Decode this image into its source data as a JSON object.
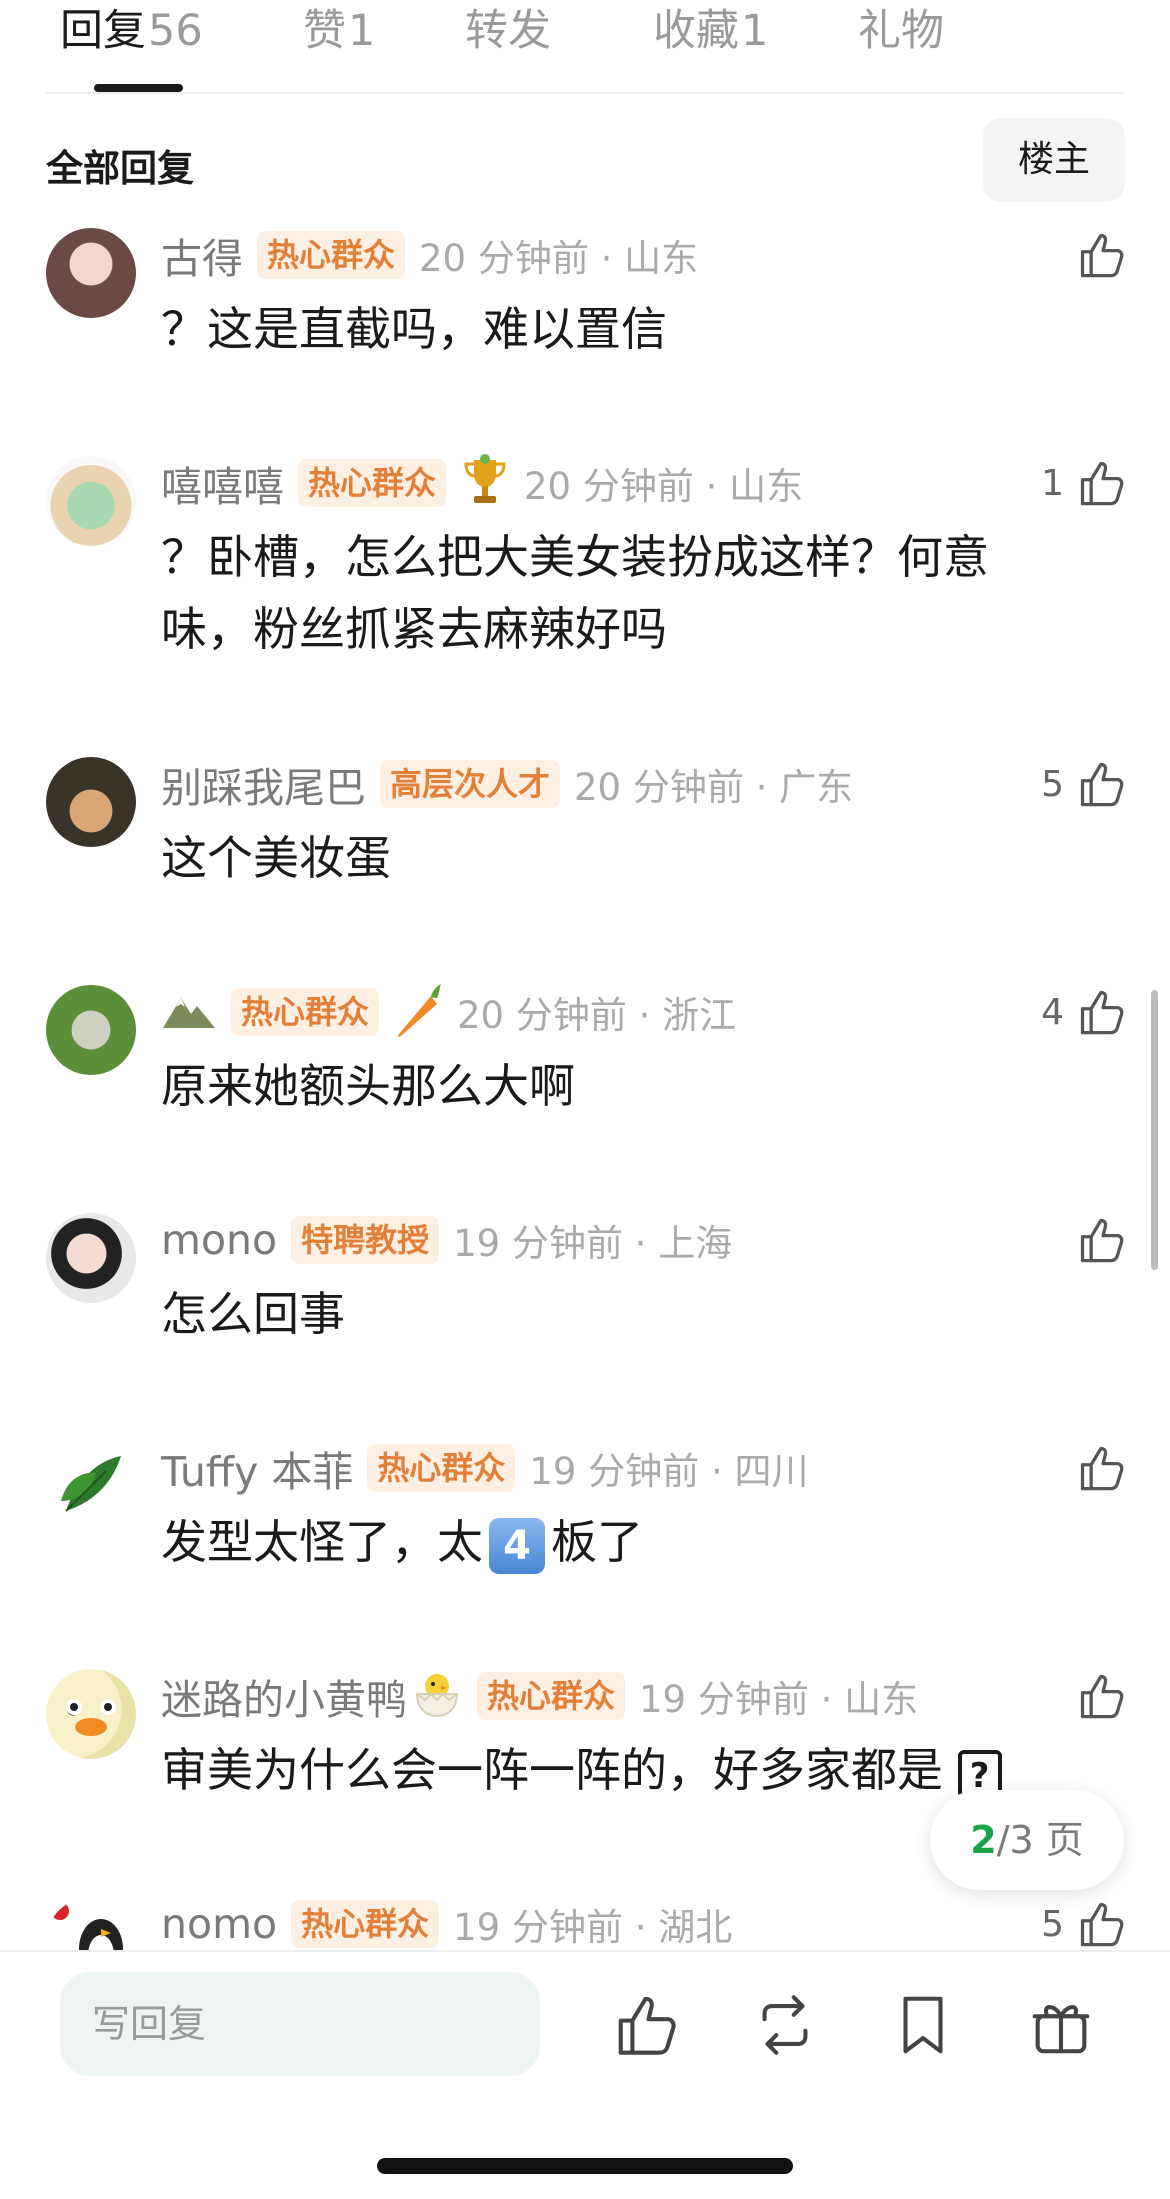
{
  "tabs": [
    {
      "label": "回复",
      "count": "56"
    },
    {
      "label": "赞",
      "count": "1"
    },
    {
      "label": "转发",
      "count": ""
    },
    {
      "label": "收藏",
      "count": "1"
    },
    {
      "label": "礼物",
      "count": ""
    }
  ],
  "section": {
    "title": "全部回复",
    "owner_filter": "楼主"
  },
  "comments": [
    {
      "name": "古得",
      "badge": "热心群众",
      "time": "20 分钟前 · 山东",
      "text": "？这是直截吗，难以置信",
      "likes": "",
      "badge_emoji": ""
    },
    {
      "name": "嘻嘻嘻",
      "badge": "热心群众",
      "time": "20 分钟前 · 山东",
      "text": "？卧槽，怎么把大美女装扮成这样？何意味，粉丝抓紧去麻辣好吗",
      "likes": "1",
      "badge_emoji": "trophy"
    },
    {
      "name": "别踩我尾巴",
      "badge": "高层次人才",
      "time": "20 分钟前 · 广东",
      "text": "这个美妆蛋",
      "likes": "5",
      "badge_emoji": ""
    },
    {
      "name": "",
      "badge": "热心群众",
      "time": "20 分钟前 · 浙江",
      "text": "原来她额头那么大啊",
      "likes": "4",
      "badge_emoji": "carrot"
    },
    {
      "name": "mono",
      "badge": "特聘教授",
      "time": "19 分钟前 · 上海",
      "text": "怎么回事",
      "likes": "",
      "badge_emoji": ""
    },
    {
      "name": "Tuffy 本菲",
      "badge": "热心群众",
      "time": "19 分钟前 · 四川",
      "text_before": "发型太怪了，太",
      "text_key": "4",
      "text_after": "板了",
      "likes": "",
      "badge_emoji": ""
    },
    {
      "name": "迷路的小黄鸭",
      "badge": "热心群众",
      "time": "19 分钟前 · 山东",
      "text": "审美为什么会一阵一阵的，好多家都是",
      "text_box": "?",
      "likes": "",
      "badge_emoji": "hatching-chick"
    },
    {
      "name": "nomo",
      "badge": "热心群众",
      "time": "19 分钟前 · 湖北",
      "text": "",
      "likes": "5",
      "badge_emoji": ""
    }
  ],
  "pager": {
    "current": "2",
    "total_label": "/3 页"
  },
  "bottom_bar": {
    "reply_placeholder": "写回复"
  },
  "colors": {
    "badge_text": "#e2803a",
    "badge_bg": "#fdf0e3",
    "pager_current": "#1aa34a"
  }
}
